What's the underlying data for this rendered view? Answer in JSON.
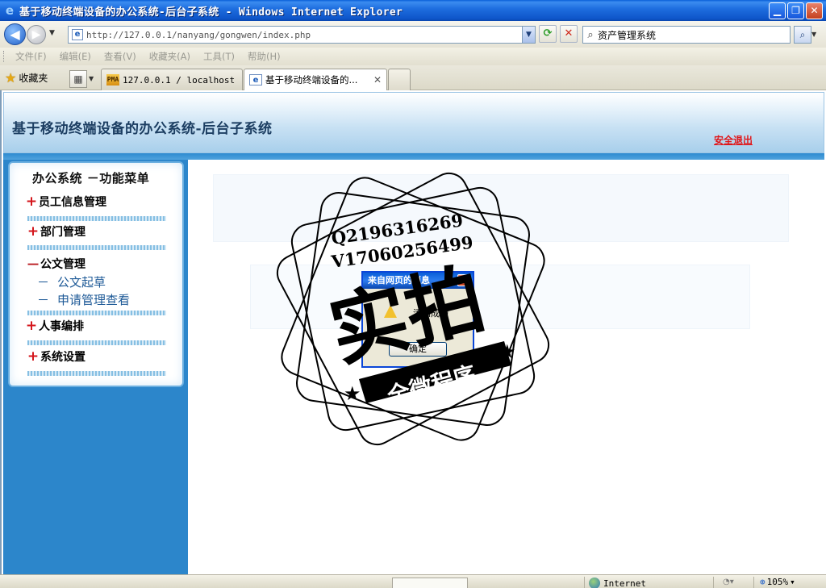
{
  "window": {
    "title": "基于移动终端设备的办公系统-后台子系统 - Windows Internet Explorer",
    "minimize": "▁",
    "maximize": "❐",
    "close": "✕"
  },
  "address_bar": {
    "url": "http://127.0.0.1/nanyang/gongwen/index.php",
    "search_value": "资产管理系统"
  },
  "menubar": {
    "items": [
      "文件(F)",
      "编辑(E)",
      "查看(V)",
      "收藏夹(A)",
      "工具(T)",
      "帮助(H)"
    ]
  },
  "tabs": {
    "favorites_label": "收藏夹",
    "tab1_icon_text": "PMA",
    "tab1_label": "127.0.0.1 / localhost ...",
    "tab2_label": "基于移动终端设备的...",
    "tab_close": "✕"
  },
  "app": {
    "title": "基于移动终端设备的办公系统-后台子系统",
    "logout_label": "安全退出",
    "menu_title": "办公系统 －功能菜单",
    "menu": {
      "employee": "员工信息管理",
      "department": "部门管理",
      "document": "公文管理",
      "doc_draft": "公文起草",
      "doc_apply": "申请管理查看",
      "personnel": "人事编排",
      "settings": "系统设置"
    },
    "sign_plus": "+",
    "sign_minus": "－",
    "sub_dash": "－"
  },
  "dialog": {
    "title": "来自网页的消息",
    "message": "添加成功",
    "ok_label": "确定",
    "close_label": "✕"
  },
  "watermark": {
    "qq": "Q2196316269",
    "v": "V17060256499",
    "big": "实拍",
    "banner": "全微程序"
  },
  "statusbar": {
    "zone": "Internet",
    "zoom": "105%"
  },
  "colors": {
    "sidebar_blue": "#2C86CB",
    "logout_red": "#E0171A",
    "title_blue": "#1C3E62"
  }
}
